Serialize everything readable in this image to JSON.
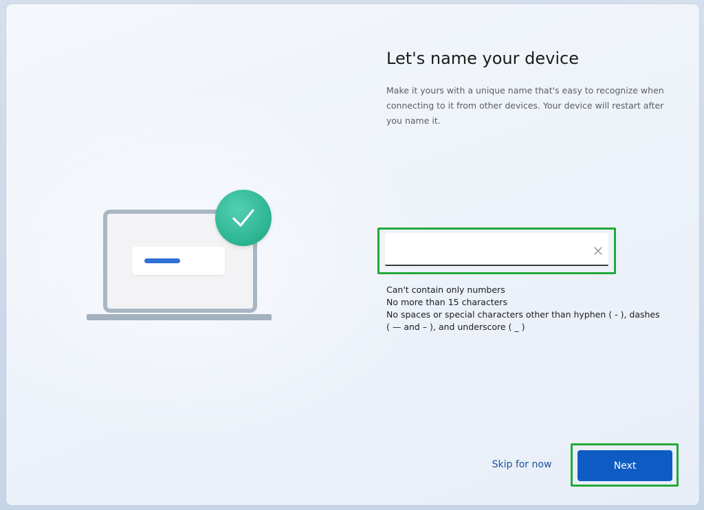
{
  "page": {
    "title": "Let's name your device",
    "description": "Make it yours with a unique name that's easy to recognize when connecting to it from other devices. Your device will restart after you name it."
  },
  "name_input": {
    "value": "",
    "placeholder": "",
    "clear_icon": "close-icon"
  },
  "rules": [
    "Can't contain only numbers",
    "No more than 15 characters",
    "No spaces or special characters other than hyphen ( - ), dashes",
    "( — and – ), and underscore ( _ )"
  ],
  "actions": {
    "skip_label": "Skip for now",
    "next_label": "Next"
  },
  "illustration": {
    "icons": [
      "laptop-icon",
      "checkmark-icon"
    ]
  },
  "colors": {
    "accent": "#0f5bc4",
    "check_badge": "#2bb38f",
    "highlight": "#22a83a",
    "link": "#1c4f9c"
  }
}
